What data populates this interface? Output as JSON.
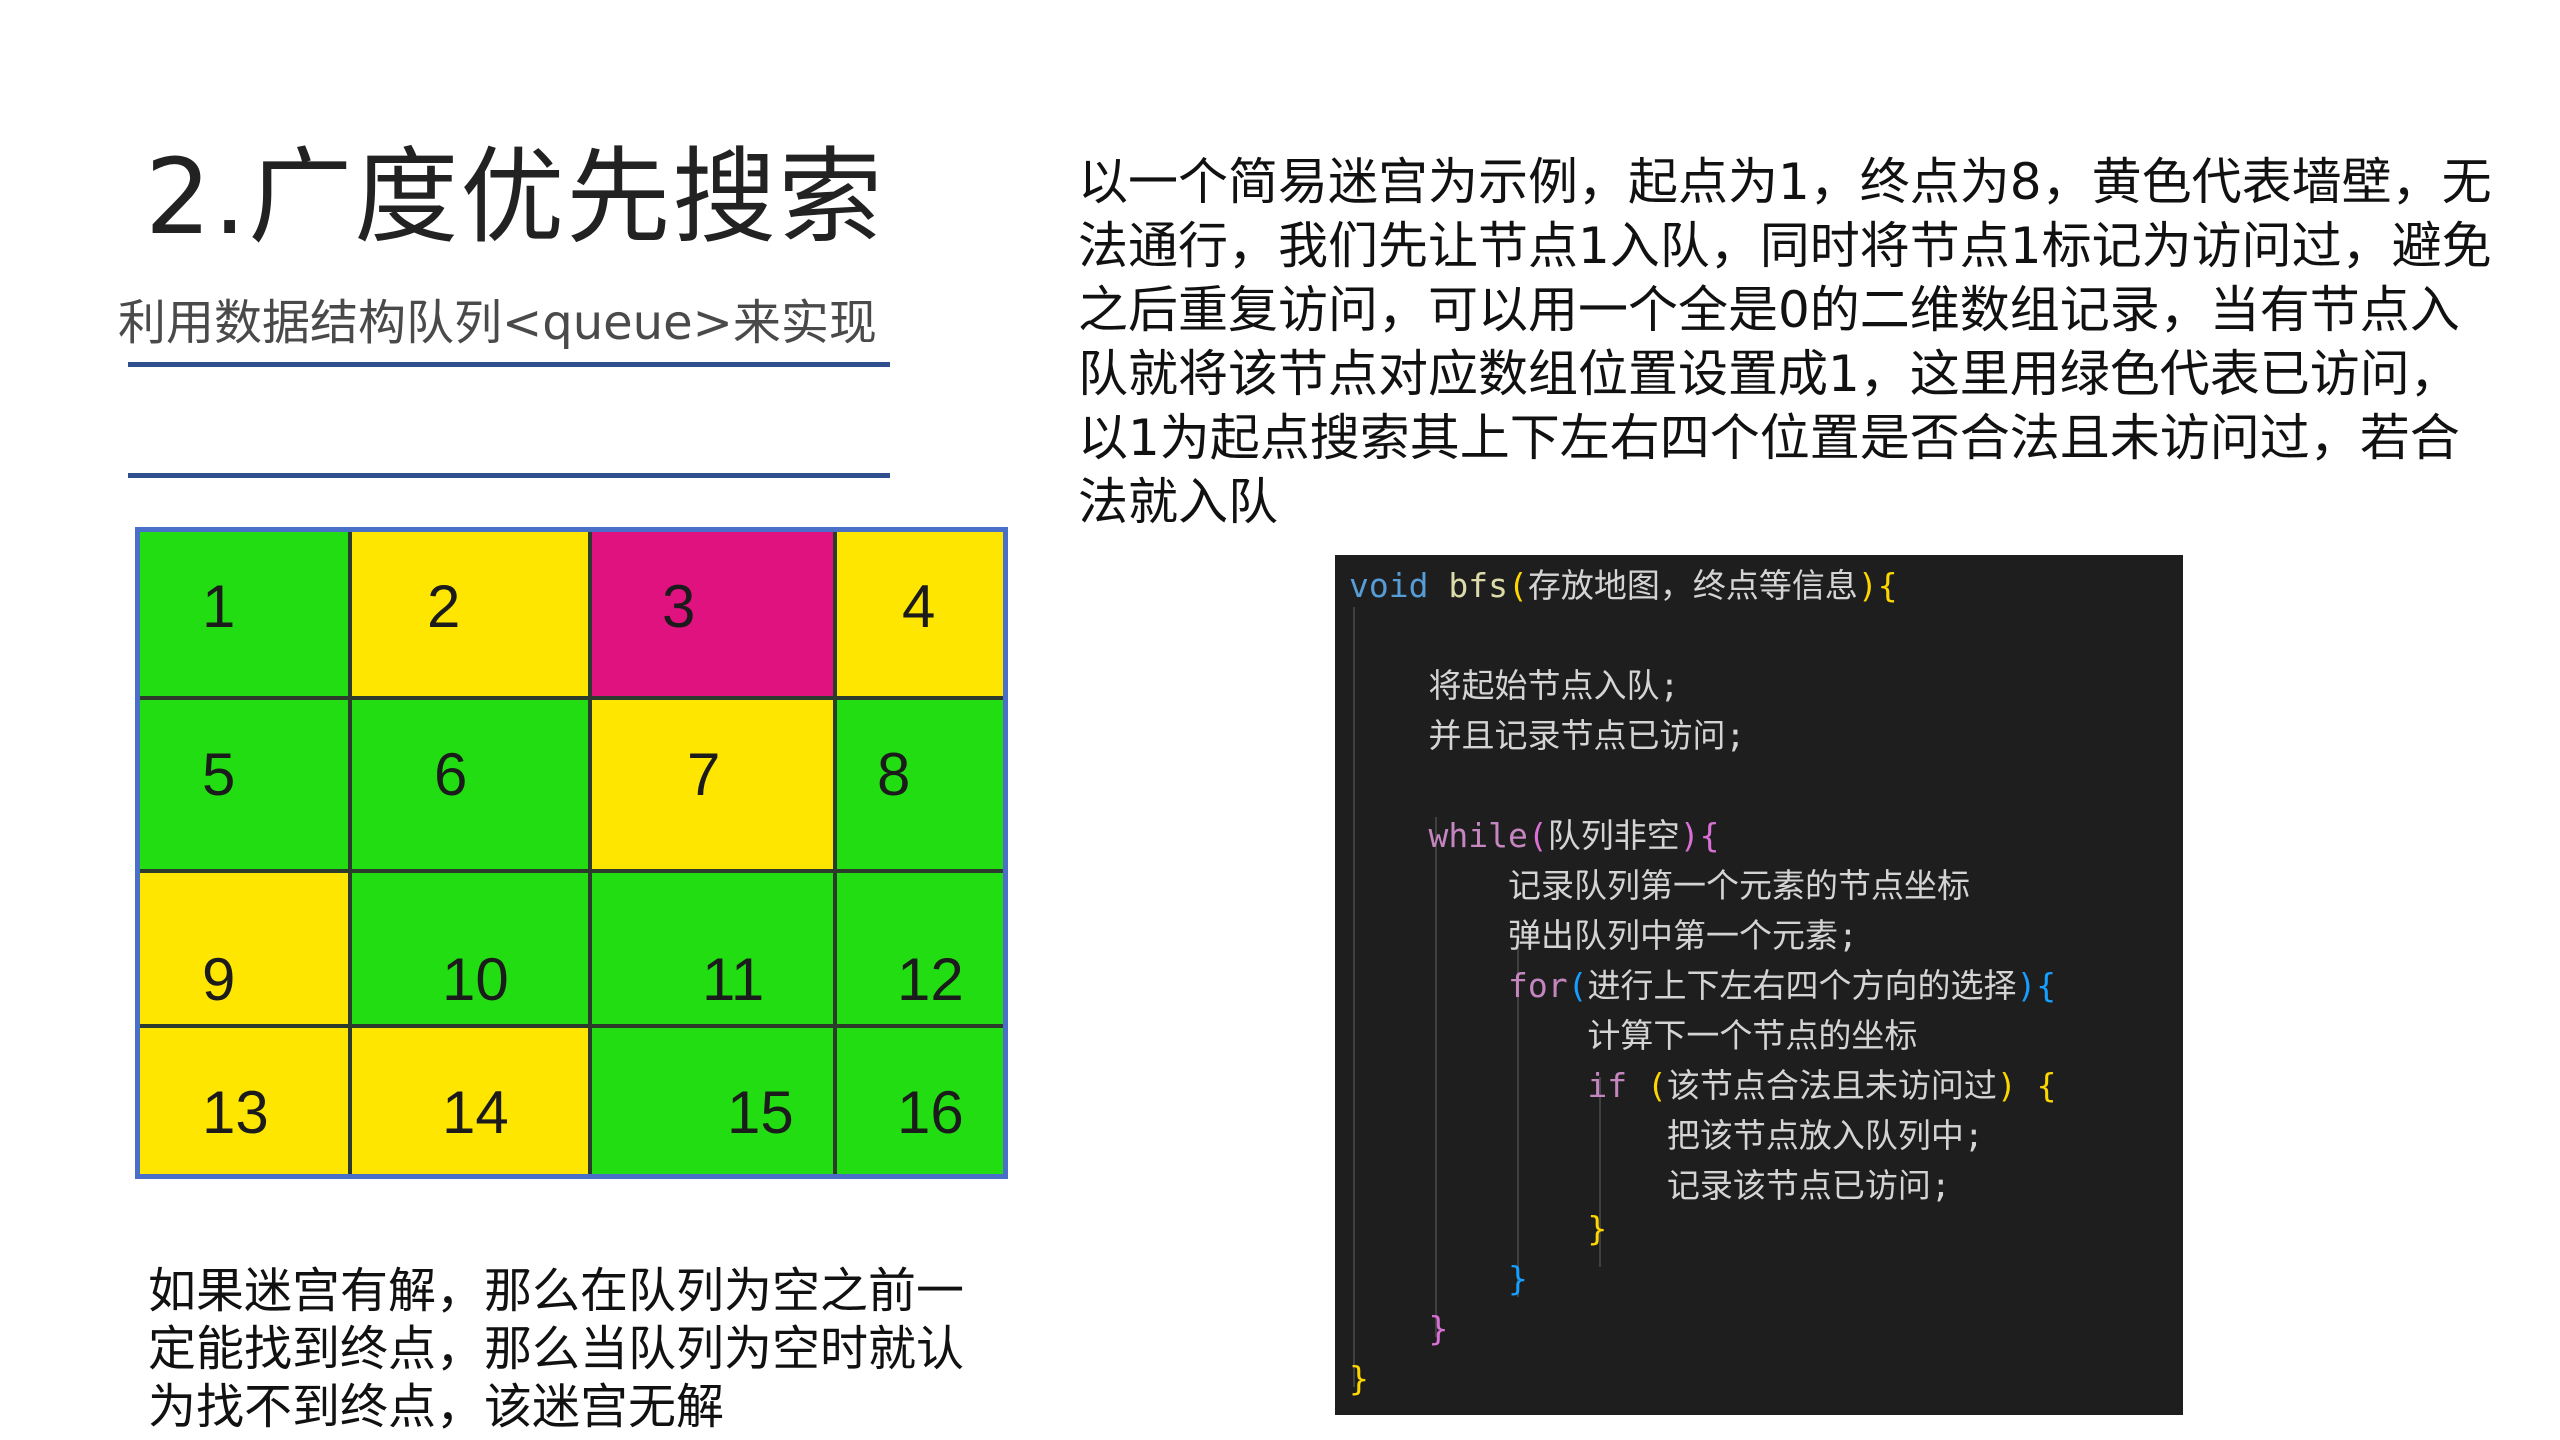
{
  "slide": {
    "title": "2.广度优先搜索",
    "subtitle": "利用数据结构队列<queue>来实现",
    "description": "以一个简易迷宫为示例，起点为1，终点为8，黄色代表墙壁，无法通行，我们先让节点1入队，同时将节点1标记为访问过，避免之后重复访问，可以用一个全是0的二维数组记录，当有节点入队就将该节点对应数组位置设置成1，这里用绿色代表已访问，以1为起点搜索其上下左右四个位置是否合法且未访问过，若合法就入队",
    "note": "如果迷宫有解，那么在队列为空之前一定能找到终点，那么当队列为空时就认为找不到终点，该迷宫无解"
  },
  "colors": {
    "green": "#22dd11",
    "yellow": "#ffe600",
    "magenta": "#e0127f",
    "rule": "#2f4f8f",
    "grid_border": "#4a6fc9"
  },
  "maze": {
    "cells": [
      {
        "label": "1",
        "color": "green"
      },
      {
        "label": "2",
        "color": "yellow"
      },
      {
        "label": "3",
        "color": "magenta"
      },
      {
        "label": "4",
        "color": "yellow"
      },
      {
        "label": "5",
        "color": "green"
      },
      {
        "label": "6",
        "color": "green"
      },
      {
        "label": "7",
        "color": "yellow"
      },
      {
        "label": "8",
        "color": "green"
      },
      {
        "label": "9",
        "color": "yellow"
      },
      {
        "label": "10",
        "color": "green"
      },
      {
        "label": "11",
        "color": "green"
      },
      {
        "label": "12",
        "color": "green"
      },
      {
        "label": "13",
        "color": "yellow"
      },
      {
        "label": "14",
        "color": "yellow"
      },
      {
        "label": "15",
        "color": "green"
      },
      {
        "label": "16",
        "color": "green"
      }
    ]
  },
  "code": {
    "lines": [
      [
        {
          "t": "void ",
          "c": "kw-blue"
        },
        {
          "t": "bfs",
          "c": "fn"
        },
        {
          "t": "(",
          "c": "br-gold"
        },
        {
          "t": "存放地图，终点等信息",
          "c": ""
        },
        {
          "t": "){",
          "c": "br-gold"
        }
      ],
      [],
      [
        {
          "t": "    将起始节点入队;",
          "c": ""
        }
      ],
      [
        {
          "t": "    并且记录节点已访问;",
          "c": ""
        }
      ],
      [],
      [
        {
          "t": "    ",
          "c": ""
        },
        {
          "t": "while",
          "c": "kw-pink"
        },
        {
          "t": "(",
          "c": "br-pink"
        },
        {
          "t": "队列非空",
          "c": ""
        },
        {
          "t": "){",
          "c": "br-pink"
        }
      ],
      [
        {
          "t": "        记录队列第一个元素的节点坐标",
          "c": ""
        }
      ],
      [
        {
          "t": "        弹出队列中第一个元素;",
          "c": ""
        }
      ],
      [
        {
          "t": "        ",
          "c": ""
        },
        {
          "t": "for",
          "c": "kw-pink"
        },
        {
          "t": "(",
          "c": "br-blue"
        },
        {
          "t": "进行上下左右四个方向的选择",
          "c": ""
        },
        {
          "t": "){",
          "c": "br-blue"
        }
      ],
      [
        {
          "t": "            计算下一个节点的坐标",
          "c": ""
        }
      ],
      [
        {
          "t": "            ",
          "c": ""
        },
        {
          "t": "if",
          "c": "kw-pink"
        },
        {
          "t": " ",
          "c": ""
        },
        {
          "t": "(",
          "c": "br-gold"
        },
        {
          "t": "该节点合法且未访问过",
          "c": ""
        },
        {
          "t": ") {",
          "c": "br-gold"
        }
      ],
      [
        {
          "t": "                把该节点放入队列中;",
          "c": ""
        }
      ],
      [
        {
          "t": "                记录该节点已访问;",
          "c": ""
        }
      ],
      [
        {
          "t": "            }",
          "c": "br-gold"
        }
      ],
      [
        {
          "t": "        }",
          "c": "br-blue"
        }
      ],
      [
        {
          "t": "    }",
          "c": "br-pink"
        }
      ],
      [
        {
          "t": "}",
          "c": "br-gold"
        }
      ]
    ]
  }
}
